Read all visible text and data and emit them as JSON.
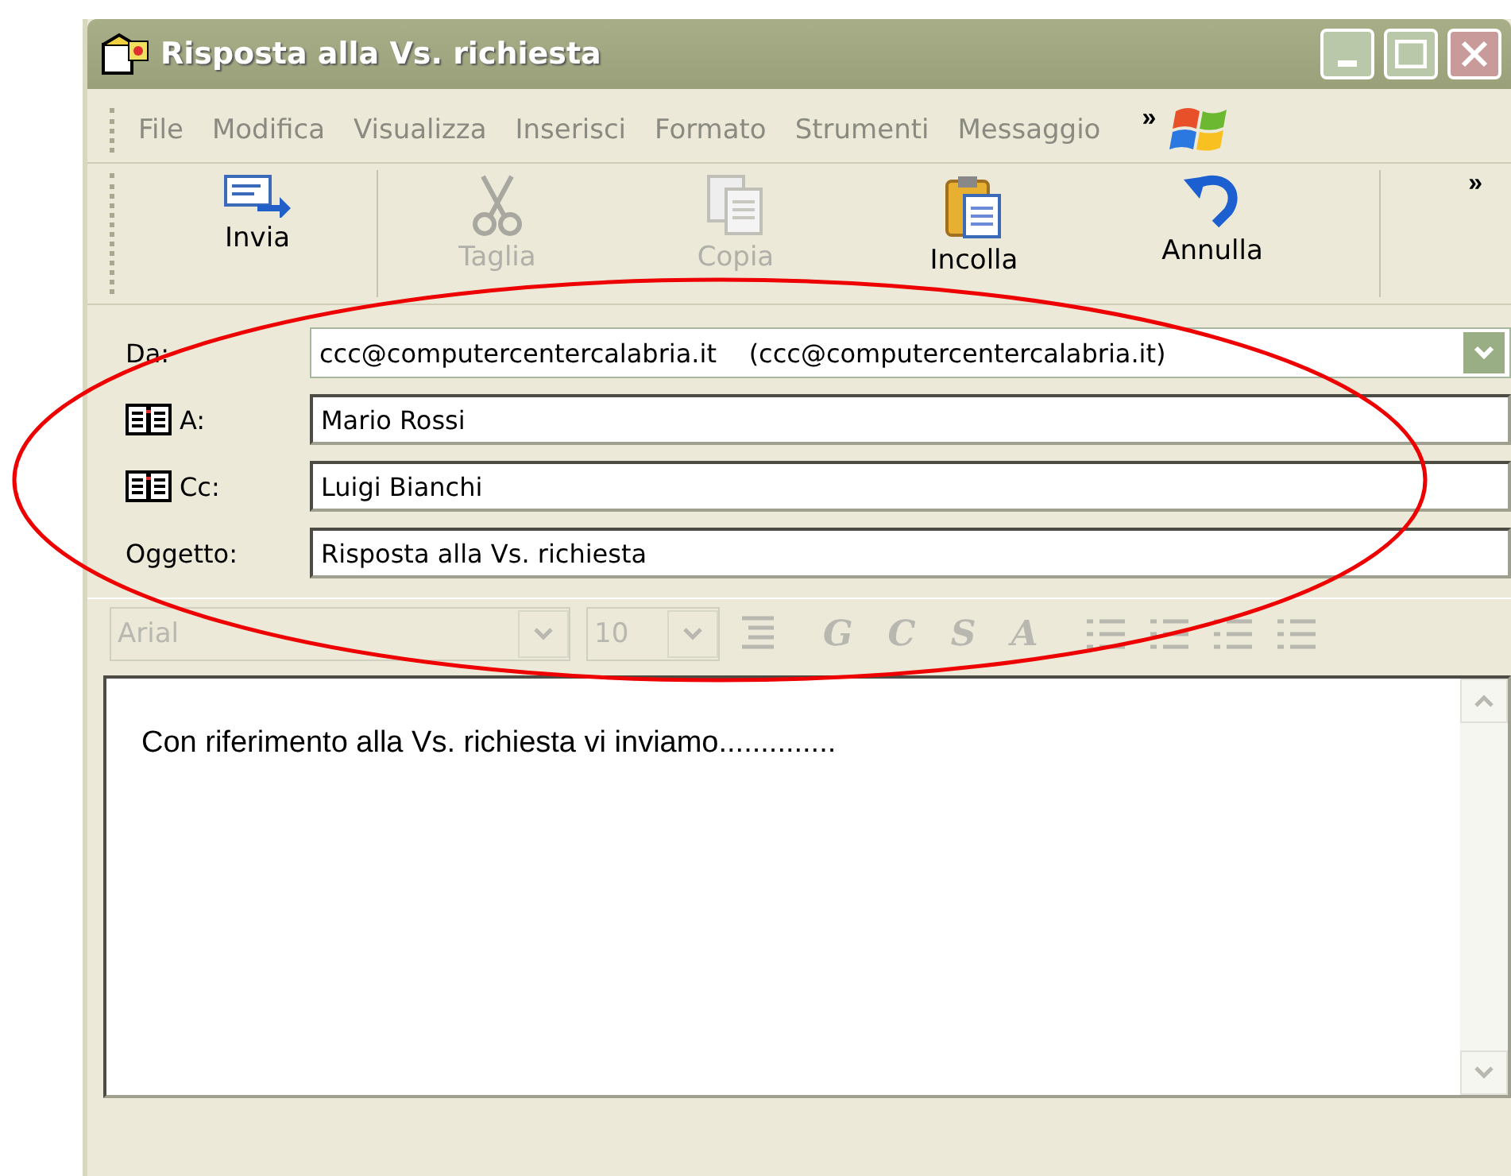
{
  "window": {
    "title": "Risposta alla Vs. richiesta",
    "active": false
  },
  "menu": [
    {
      "label": "File"
    },
    {
      "label": "Modifica"
    },
    {
      "label": "Visualizza"
    },
    {
      "label": "Inserisci"
    },
    {
      "label": "Formato"
    },
    {
      "label": "Strumenti"
    },
    {
      "label": "Messaggio"
    }
  ],
  "menu_more": "»",
  "toolbar": [
    {
      "kind": "send",
      "label": "Invia",
      "disabled": false
    },
    {
      "kind": "cut",
      "label": "Taglia",
      "disabled": true
    },
    {
      "kind": "copy",
      "label": "Copia",
      "disabled": true
    },
    {
      "kind": "paste",
      "label": "Incolla",
      "disabled": false
    },
    {
      "kind": "undo",
      "label": "Annulla",
      "disabled": false
    }
  ],
  "toolbar_more": "»",
  "header_fields": [
    {
      "kind": "dropdown",
      "label": "Da:",
      "address_book": false,
      "value": "ccc@computercentercalabria.it    (ccc@computercentercalabria.it)"
    },
    {
      "kind": "text",
      "label": "A:",
      "address_book": true,
      "value": "Mario Rossi"
    },
    {
      "kind": "text",
      "label": "Cc:",
      "address_book": true,
      "value": "Luigi Bianchi"
    },
    {
      "kind": "text",
      "label": "Oggetto:",
      "address_book": false,
      "value": "Risposta alla Vs. richiesta"
    }
  ],
  "format_bar": {
    "disabled": true,
    "font": "Arial",
    "size": "10",
    "styles": [
      "G",
      "C",
      "S",
      "A"
    ]
  },
  "body": {
    "text": "Con riferimento alla Vs. richiesta vi inviamo.............."
  },
  "annotation": {
    "kind": "ellipse",
    "color": "#ee0000"
  }
}
